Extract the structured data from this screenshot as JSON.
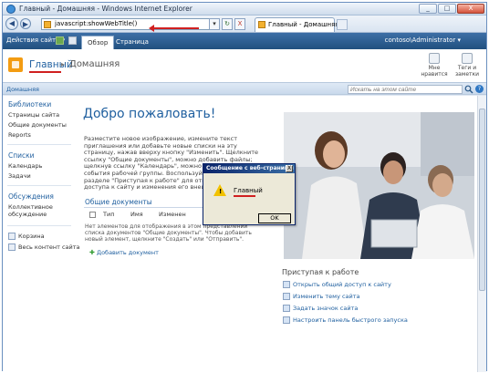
{
  "window": {
    "title": "Главный - Домашняя - Windows Internet Explorer",
    "minimize": "_",
    "maximize": "□",
    "close": "X"
  },
  "browser": {
    "url": "javascript:showWebTitle()",
    "refresh": "↻",
    "stop": "X",
    "go": "▸",
    "back": "◀",
    "forward": "▶",
    "tab_title": "Главный - Домашняя"
  },
  "ribbon": {
    "site_actions": "Действия сайта ▾",
    "tabs": [
      "Обзор",
      "Страница"
    ],
    "user": "contoso\\Administrator ▾"
  },
  "title_area": {
    "home": "Главный",
    "separator": "▸",
    "page": "Домашняя",
    "actions": [
      {
        "label_1": "Мне",
        "label_2": "нравится"
      },
      {
        "label_1": "Теги и",
        "label_2": "заметки"
      }
    ]
  },
  "strip": {
    "home_link": "Домашняя",
    "search_placeholder": "Искать на этом сайте",
    "help": "?"
  },
  "quicklaunch": {
    "libraries_head": "Библиотеки",
    "libraries": [
      "Страницы сайта",
      "Общие документы",
      "Reports"
    ],
    "lists_head": "Списки",
    "lists": [
      "Календарь",
      "Задачи"
    ],
    "discussions_head": "Обсуждения",
    "discussions": [
      "Коллективное",
      "обсуждение"
    ],
    "recycle": "Корзина",
    "all_content": "Весь контент сайта"
  },
  "main": {
    "welcome": "Добро пожаловать!",
    "intro": "Разместите новое изображение, измените текст приглашения или добавьте новые списки на эту страницу, нажав вверху кнопку \"Изменить\". Щелкните ссылку \"Общие документы\", можно добавить файлы; щелкнув ссылку \"Календарь\", можно создать новые события рабочей группы. Воспользуйтесь ссылками в разделе \"Приступая к работе\" для открытия общего доступа к сайту и изменения его внешнего вида.",
    "doclib_title": "Общие документы",
    "columns": [
      "Тип",
      "Имя",
      "Изменен"
    ],
    "empty_msg": "Нет элементов для отображения в этом представлении списка документов \"Общие документы\". Чтобы добавить новый элемент, щелкните \"Создать\" или \"Отправить\".",
    "add_doc": "Добавить документ"
  },
  "getting_started": {
    "title": "Приступая к работе",
    "items": [
      "Открыть общий доступ к сайту",
      "Изменить тему сайта",
      "Задать значок сайта",
      "Настроить панель быстрого запуска"
    ]
  },
  "dialog": {
    "title": "Сообщение с веб-страницы",
    "message": "Главный",
    "ok": "OK",
    "close": "X"
  }
}
